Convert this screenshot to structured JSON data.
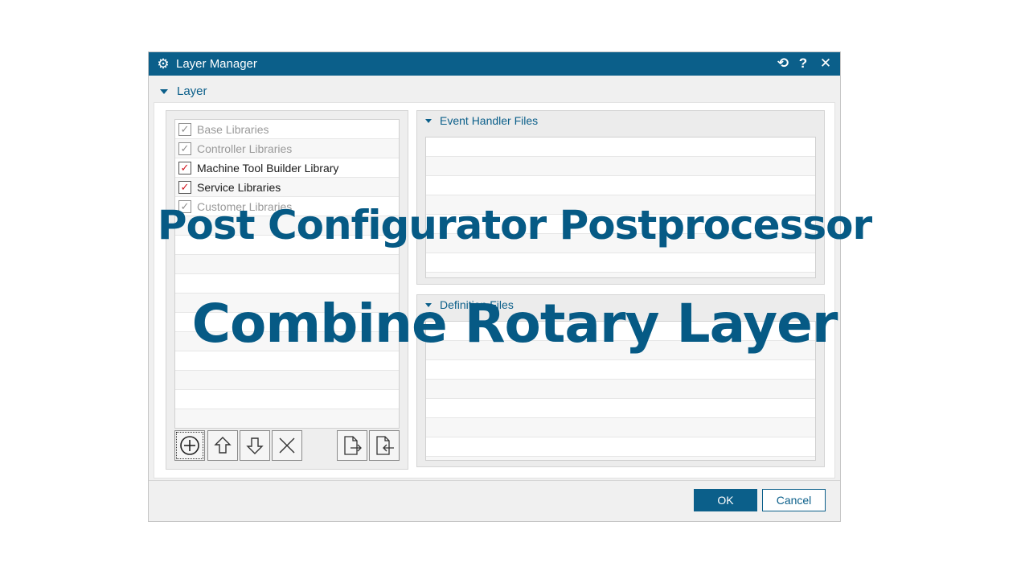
{
  "window": {
    "title": "Layer Manager",
    "icons": {
      "app": "gear-icon",
      "reset": "reset-icon",
      "help": "help-icon",
      "close": "close-icon"
    },
    "reset_glyph": "⟲",
    "help_glyph": "?",
    "close_glyph": "✕",
    "gear_glyph": "⚙"
  },
  "section": {
    "label": "Layer"
  },
  "layers": [
    {
      "label": "Base Libraries",
      "checked": true,
      "enabled": false
    },
    {
      "label": "Controller Libraries",
      "checked": true,
      "enabled": false
    },
    {
      "label": "Machine Tool Builder Library",
      "checked": true,
      "enabled": true
    },
    {
      "label": "Service Libraries",
      "checked": true,
      "enabled": true
    },
    {
      "label": "Customer Libraries",
      "checked": true,
      "enabled": false
    }
  ],
  "toolbar": {
    "buttons": [
      "add-icon",
      "move-up-icon",
      "move-down-icon",
      "delete-icon",
      "export-icon",
      "import-icon"
    ]
  },
  "panels": {
    "event_handler": {
      "label": "Event Handler Files"
    },
    "definition": {
      "label": "Definition Files"
    }
  },
  "footer": {
    "ok": "OK",
    "cancel": "Cancel"
  },
  "overlay": {
    "line1": "Post Configurator Postprocessor",
    "line2": "Combine Rotary Layer"
  },
  "colors": {
    "accent": "#0b5f8a",
    "check": "#d0141e",
    "overlay_text": "#065a85"
  }
}
